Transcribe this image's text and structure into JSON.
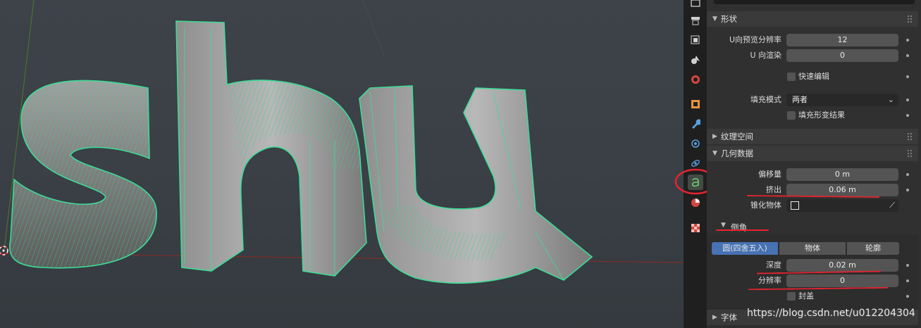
{
  "panel": {
    "shape_header": "形状",
    "u_preview_label": "U向预览分辨率",
    "u_preview_value": "12",
    "u_render_label": "U 向渲染",
    "u_render_value": "0",
    "fast_edit_label": "快速编辑",
    "fill_mode_label": "填充模式",
    "fill_mode_value": "两者",
    "fill_deform_label": "填充形变结果",
    "texture_space_header": "纹理空间",
    "geometry_header": "几何数据",
    "offset_label": "偏移量",
    "offset_value": "0 m",
    "extrude_label": "挤出",
    "extrude_value": "0.06 m",
    "taper_label": "锥化物体",
    "bevel_header": "倒角",
    "bevel_modes": [
      "圆(四舍五入)",
      "物体",
      "轮廓"
    ],
    "depth_label": "深度",
    "depth_value": "0.02 m",
    "resolution_label": "分辨率",
    "resolution_value": "0",
    "cap_label": "封盖",
    "font_header": "字体"
  },
  "watermark": "https://blog.csdn.net/u012204304",
  "colors": {
    "accent": "#4772b3",
    "wire": "#3ddc97",
    "annotation": "#e8232f",
    "panel_bg": "#303030"
  },
  "tabs": [
    "render-icon",
    "output-icon",
    "view-layer-icon",
    "scene-icon",
    "world-icon",
    "object-icon",
    "modifier-icon",
    "particles-icon",
    "physics-icon",
    "text-data-icon",
    "material-icon",
    "texture-icon"
  ]
}
